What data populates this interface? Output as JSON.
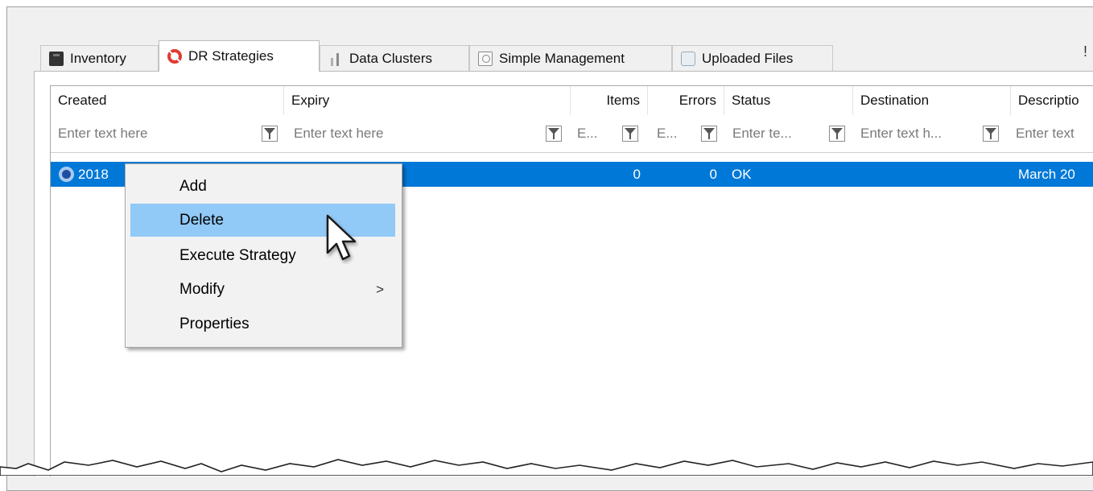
{
  "tabs": [
    {
      "label": "Inventory",
      "icon": "inventory-icon"
    },
    {
      "label": "DR Strategies",
      "icon": "lifebuoy-icon",
      "active": true
    },
    {
      "label": "Data Clusters",
      "icon": "data-clusters-icon"
    },
    {
      "label": "Simple Management",
      "icon": "simple-management-icon"
    },
    {
      "label": "Uploaded Files",
      "icon": "uploaded-files-icon"
    }
  ],
  "tab_overflow_glyph": "!",
  "grid": {
    "columns": [
      {
        "header": "Created",
        "filter_placeholder": "Enter text here"
      },
      {
        "header": "Expiry",
        "filter_placeholder": "Enter text here"
      },
      {
        "header": "Items",
        "filter_placeholder": "E..."
      },
      {
        "header": "Errors",
        "filter_placeholder": "E..."
      },
      {
        "header": "Status",
        "filter_placeholder": "Enter te..."
      },
      {
        "header": "Destination",
        "filter_placeholder": "Enter text h..."
      },
      {
        "header": "Descriptio",
        "filter_placeholder": "Enter text"
      }
    ],
    "rows": [
      {
        "created": "2018",
        "expiry": "",
        "items": "0",
        "errors": "0",
        "status": "OK",
        "destination": "",
        "description": "March 20",
        "selected": true
      }
    ]
  },
  "context_menu": {
    "items": [
      {
        "label": "Add"
      },
      {
        "label": "Delete",
        "highlighted": true
      },
      {
        "label": "Execute Strategy"
      },
      {
        "label": "Modify",
        "submenu_arrow": ">"
      },
      {
        "label": "Properties"
      }
    ]
  },
  "colors": {
    "selection": "#0078d7",
    "menu_highlight": "#91c9f7",
    "tab_icon_red": "#e03c31"
  }
}
